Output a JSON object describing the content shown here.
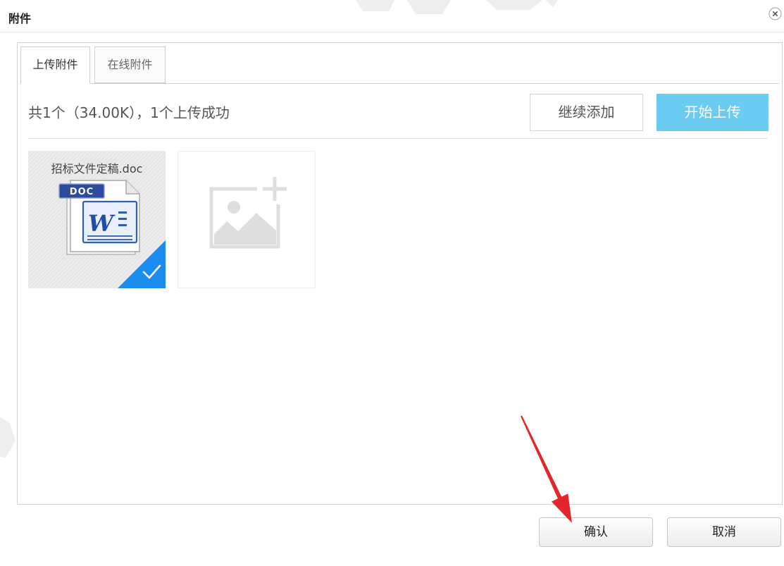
{
  "dialog": {
    "title": "附件",
    "close_icon": "close-icon"
  },
  "tabs": [
    {
      "label": "上传附件",
      "active": true
    },
    {
      "label": "在线附件",
      "active": false
    }
  ],
  "upload": {
    "status_text": "共1个（34.00K），1个上传成功",
    "continue_add_label": "继续添加",
    "start_upload_label": "开始上传",
    "files": [
      {
        "name": "招标文件定稿.doc",
        "icon": "doc-file-icon",
        "badge": "DOC",
        "logo_letter": "W",
        "uploaded": true,
        "status_icon": "checkmark-icon"
      }
    ],
    "add_tile_icon": "add-image-icon"
  },
  "footer": {
    "confirm_label": "确认",
    "cancel_label": "取消"
  },
  "overlay": {
    "annotation_icon": "red-arrow-icon",
    "watermark_icon": "watermark-fragment"
  },
  "colors": {
    "accent_blue": "#1b8def",
    "upload_button": "#6ccbf2",
    "annotation_red": "#e3262b",
    "border": "#cfcfcf"
  }
}
